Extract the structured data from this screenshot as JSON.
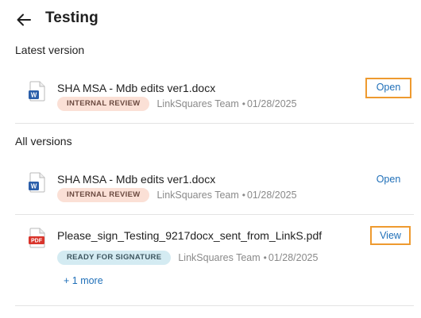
{
  "header": {
    "title": "Testing",
    "back_icon": "arrow-left-icon"
  },
  "latest": {
    "section_label": "Latest version",
    "file": {
      "name": "SHA MSA - Mdb edits ver1.docx",
      "icon": "word-document-icon",
      "status": "INTERNAL REVIEW",
      "owner": "LinkSquares Team",
      "separator": "•",
      "date": "01/28/2025",
      "action": "Open"
    }
  },
  "all_versions": {
    "section_label": "All versions",
    "files": [
      {
        "name": "SHA MSA - Mdb edits ver1.docx",
        "icon": "word-document-icon",
        "status": "INTERNAL REVIEW",
        "owner": "LinkSquares Team",
        "separator": "•",
        "date": "01/28/2025",
        "action": "Open"
      },
      {
        "name": "Please_sign_Testing_9217docx_sent_from_LinkS.pdf",
        "icon": "pdf-document-icon",
        "status": "READY FOR SIGNATURE",
        "owner": "LinkSquares Team",
        "separator": "•",
        "date": "01/28/2025",
        "action": "View",
        "more": "+ 1 more"
      }
    ]
  },
  "colors": {
    "link": "#1f6fb8",
    "highlight_border": "#ee9a2f",
    "badge_review_bg": "#fbe0d6",
    "badge_signature_bg": "#d4ebf2",
    "word_blue": "#2b5faa",
    "pdf_red": "#d9342b"
  }
}
